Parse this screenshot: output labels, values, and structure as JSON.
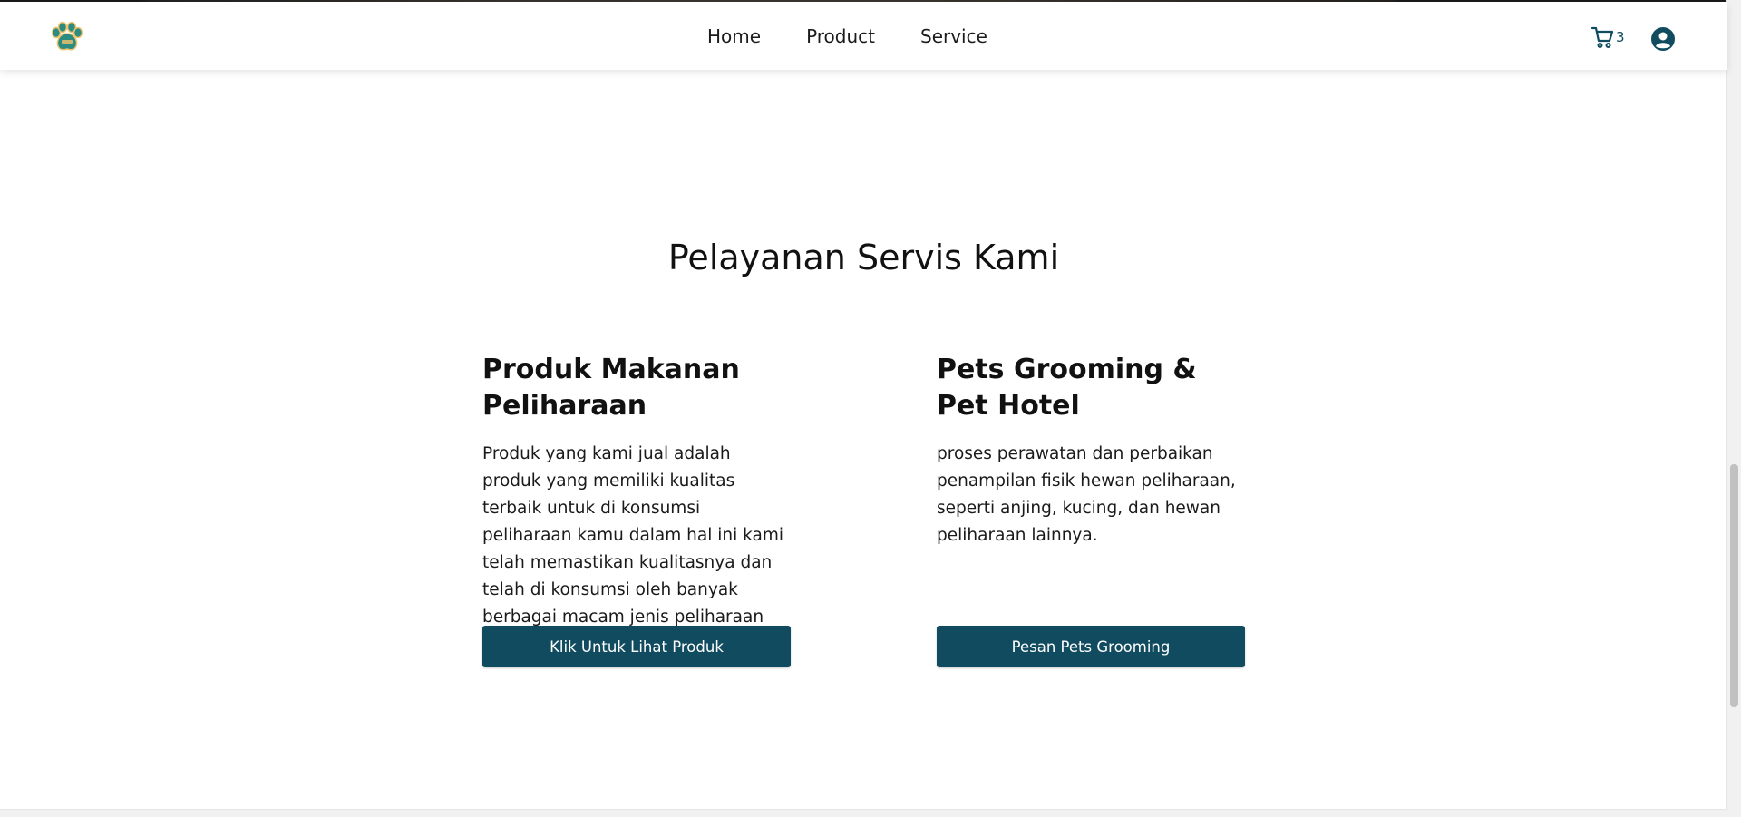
{
  "header": {
    "logo_icon": "paw-logo-icon",
    "nav": [
      "Home",
      "Product",
      "Service"
    ],
    "cart_icon": "cart-icon",
    "cart_count": "3",
    "user_icon": "user-circle-icon"
  },
  "main": {
    "title": "Pelayanan Servis Kami",
    "cards": [
      {
        "title": "Produk Makanan Peliharaan",
        "description": "Produk yang kami jual adalah produk yang memiliki kualitas terbaik untuk di konsumsi peliharaan kamu dalam hal ini kami telah memastikan kualitasnya dan telah di konsumsi oleh banyak berbagai macam jenis peliharaan",
        "button": "Klik Untuk Lihat Produk"
      },
      {
        "title": "Pets Grooming & Pet Hotel",
        "description": "proses perawatan dan perbaikan penampilan fisik hewan peliharaan, seperti anjing, kucing, dan hewan peliharaan lainnya.",
        "button": "Pesan Pets Grooming"
      }
    ]
  },
  "colors": {
    "primary": "#114b5f",
    "logo_teal": "#2e8b82",
    "logo_accent": "#f2c46d"
  }
}
